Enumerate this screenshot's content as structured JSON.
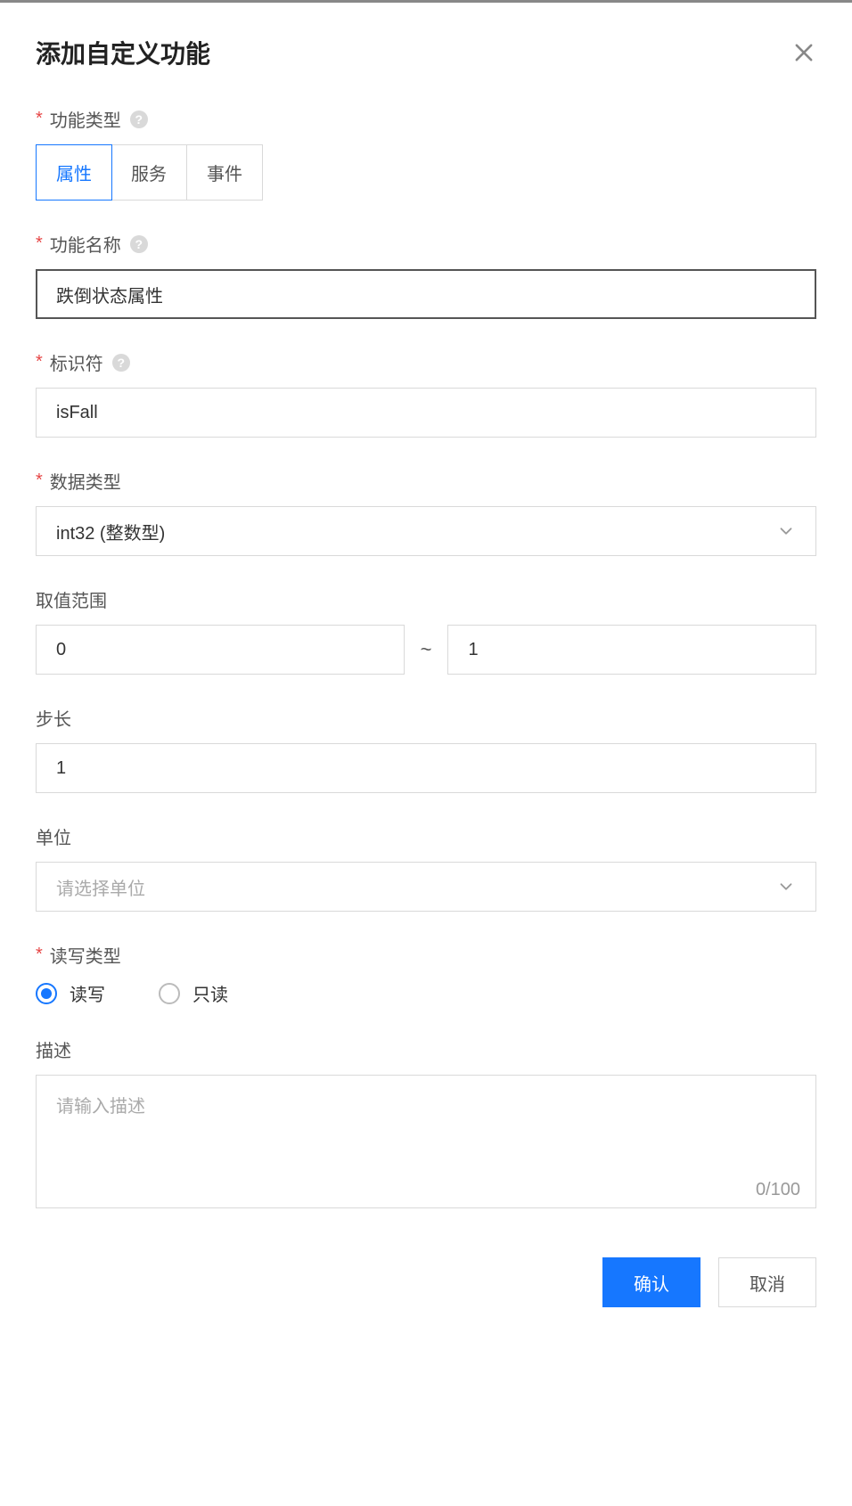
{
  "header": {
    "title": "添加自定义功能"
  },
  "functionType": {
    "label": "功能类型",
    "tabs": [
      "属性",
      "服务",
      "事件"
    ],
    "active": "属性"
  },
  "functionName": {
    "label": "功能名称",
    "value": "跌倒状态属性"
  },
  "identifier": {
    "label": "标识符",
    "value": "isFall"
  },
  "dataType": {
    "label": "数据类型",
    "value": "int32 (整数型)"
  },
  "range": {
    "label": "取值范围",
    "min": "0",
    "max": "1",
    "sep": "~"
  },
  "step": {
    "label": "步长",
    "value": "1"
  },
  "unit": {
    "label": "单位",
    "placeholder": "请选择单位"
  },
  "rwType": {
    "label": "读写类型",
    "options": [
      "读写",
      "只读"
    ],
    "selected": "读写"
  },
  "description": {
    "label": "描述",
    "placeholder": "请输入描述",
    "value": "",
    "counter": "0/100"
  },
  "footer": {
    "confirm": "确认",
    "cancel": "取消"
  }
}
